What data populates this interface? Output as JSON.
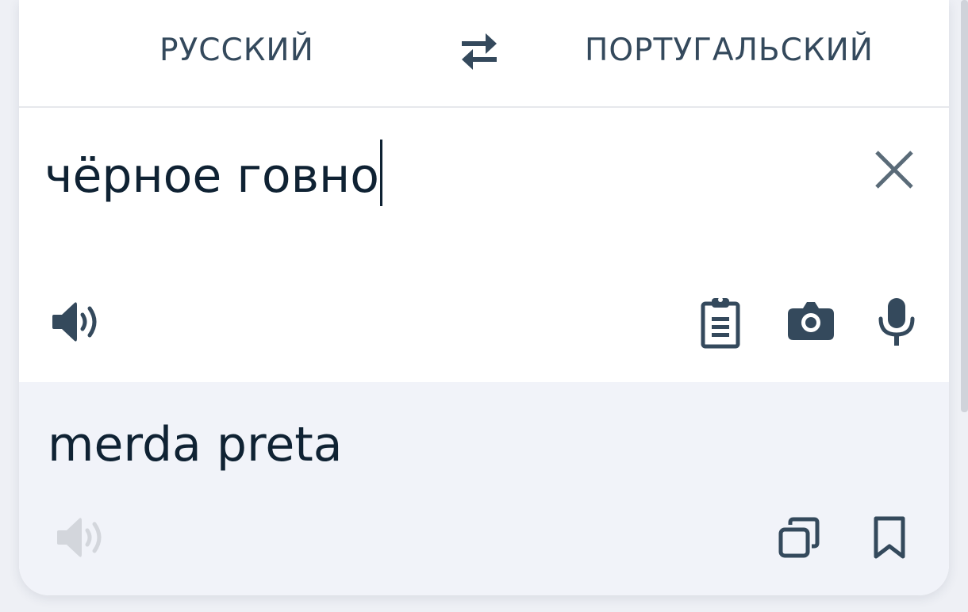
{
  "header": {
    "source_lang": "РУССКИЙ",
    "target_lang": "ПОРТУГАЛЬСКИЙ"
  },
  "input": {
    "text": "чёрное говно"
  },
  "output": {
    "text": "merda preta"
  },
  "icons": {
    "swap": "swap-arrows-icon",
    "clear": "close-icon",
    "source_speaker": "speaker-icon",
    "paste": "clipboard-icon",
    "camera": "camera-icon",
    "mic": "microphone-icon",
    "target_speaker": "speaker-icon",
    "copy": "copy-icon",
    "bookmark": "bookmark-icon"
  },
  "colors": {
    "icon": "#34495c",
    "text": "#0f2233",
    "disabled_icon": "#d3d6dc",
    "output_bg": "#f1f3f9",
    "page_bg": "#eef0f5"
  }
}
